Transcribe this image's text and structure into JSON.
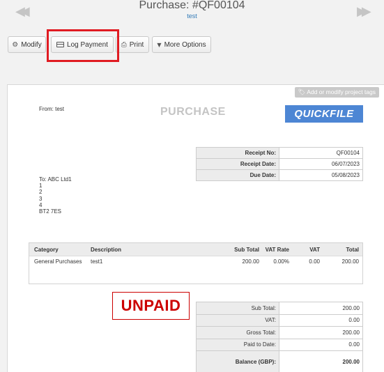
{
  "header": {
    "title": "Purchase: #QF00104",
    "subtitle": "test",
    "prev_icon": "double-chevron-left-icon",
    "next_icon": "double-chevron-right-icon"
  },
  "toolbar": {
    "modify_label": "Modify",
    "log_payment_label": "Log Payment",
    "print_label": "Print",
    "more_options_label": "More Options",
    "highlight_color": "#e01b22"
  },
  "document": {
    "tags_link": "Add or modify project tags",
    "from": "From: test",
    "title": "PURCHASE",
    "logo_text": "QUICKFILE",
    "logo_color": "#4d86d4",
    "info": [
      {
        "label": "Receipt No:",
        "value": "QF00104"
      },
      {
        "label": "Receipt Date:",
        "value": "06/07/2023"
      },
      {
        "label": "Due Date:",
        "value": "05/08/2023"
      }
    ],
    "address": [
      "To: ABC Ltd1",
      "1",
      "2",
      "3",
      "4",
      "BT2 7ES"
    ],
    "items": {
      "headers": {
        "category": "Category",
        "description": "Description",
        "sub_total": "Sub Total",
        "vat_rate": "VAT Rate",
        "vat": "VAT",
        "total": "Total"
      },
      "rows": [
        {
          "category": "General Purchases",
          "description": "test1",
          "sub_total": "200.00",
          "vat_rate": "0.00%",
          "vat": "0.00",
          "total": "200.00"
        }
      ]
    },
    "status_stamp": "UNPAID",
    "status_color": "#cc0000",
    "totals": [
      {
        "label": "Sub Total:",
        "value": "200.00"
      },
      {
        "label": "VAT:",
        "value": "0.00"
      },
      {
        "label": "Gross Total:",
        "value": "200.00"
      },
      {
        "label": "Paid to Date:",
        "value": "0.00"
      },
      {
        "label": "Balance (GBP):",
        "value": "200.00"
      }
    ]
  }
}
